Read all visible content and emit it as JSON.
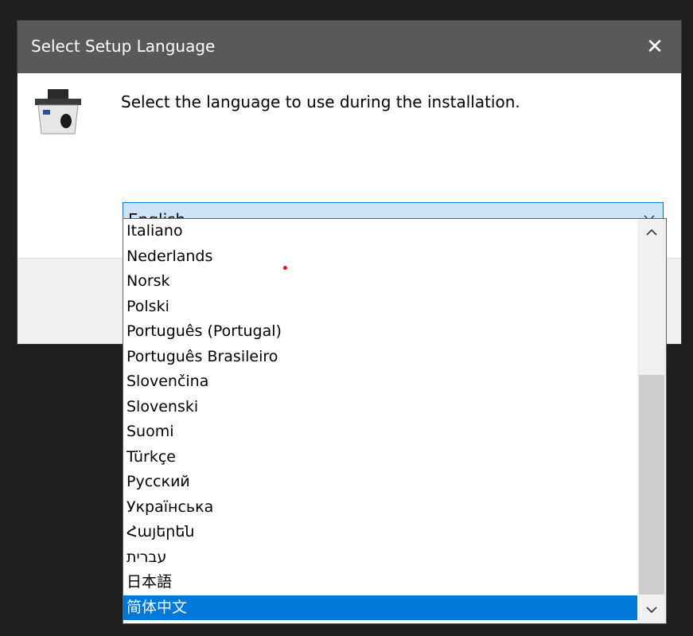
{
  "dialog": {
    "title": "Select Setup Language",
    "close_label": "✕",
    "prompt": "Select the language to use during the installation.",
    "app_icon": "installer-box-icon"
  },
  "language_select": {
    "selected_value": "English",
    "options": [
      {
        "label": "Italiano"
      },
      {
        "label": "Nederlands"
      },
      {
        "label": "Norsk"
      },
      {
        "label": "Polski"
      },
      {
        "label": "Português (Portugal)"
      },
      {
        "label": "Português Brasileiro"
      },
      {
        "label": "Slovenčina"
      },
      {
        "label": "Slovenski"
      },
      {
        "label": "Suomi"
      },
      {
        "label": "Türkçe"
      },
      {
        "label": "Русский"
      },
      {
        "label": "Українська"
      },
      {
        "label": "Հայերեն"
      },
      {
        "label": "עברית"
      },
      {
        "label": "日本語"
      },
      {
        "label": "简体中文"
      }
    ],
    "highlighted_option": "简体中文"
  },
  "colors": {
    "titlebar": "#595959",
    "accent": "#0078d7",
    "combo_fill": "#cce4f7",
    "scroll_thumb": "#cdcdcd"
  }
}
